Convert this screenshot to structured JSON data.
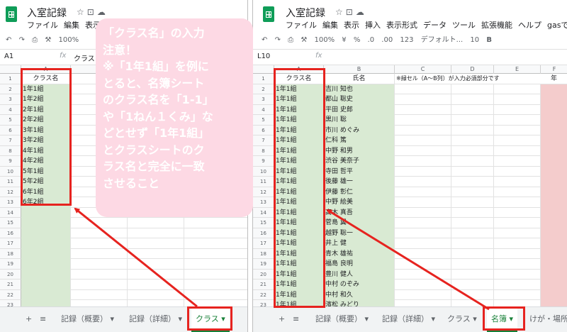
{
  "left": {
    "title": "入室記録",
    "menu": [
      "ファイル",
      "編集",
      "表示"
    ],
    "zoom": "100%",
    "cell_ref": "A1",
    "formula_value": "クラス",
    "col_header": "A",
    "header_cell": "クラス名",
    "classes": [
      "1年1組",
      "1年2組",
      "2年1組",
      "2年2組",
      "3年1組",
      "3年2組",
      "4年1組",
      "4年2組",
      "5年1組",
      "5年2組",
      "6年1組",
      "6年2組"
    ],
    "row_count": 23,
    "tabs": [
      "記録（概要）",
      "記録（詳細）",
      "クラス"
    ],
    "active_tab": "クラス"
  },
  "right": {
    "title": "入室記録",
    "menu": [
      "ファイル",
      "編集",
      "表示",
      "挿入",
      "表示形式",
      "データ",
      "ツール",
      "拡張機能",
      "ヘルプ",
      "gasで実行す"
    ],
    "toolbar": {
      "zoom": "100%",
      "currency": "¥",
      "percent": "%",
      "dec1": ".0",
      "dec2": ".00",
      "numfmt": "123",
      "font": "デフォルト...",
      "size": "10",
      "bold": "B"
    },
    "cell_ref": "L10",
    "col_headers": [
      "A",
      "B",
      "C",
      "D",
      "E",
      "F"
    ],
    "headers": {
      "class": "クラス名",
      "name": "氏名",
      "note": "※緑セル（A～B列）が入力必須部分です",
      "extra": "年"
    },
    "rows": [
      [
        "1年1組",
        "吉川 知也"
      ],
      [
        "1年1組",
        "都山 聡史"
      ],
      [
        "1年1組",
        "平田 史郎"
      ],
      [
        "1年1組",
        "黒川 聡"
      ],
      [
        "1年1組",
        "市川 めぐみ"
      ],
      [
        "1年1組",
        "仁科 篤"
      ],
      [
        "1年1組",
        "中野 和男"
      ],
      [
        "1年1組",
        "渋谷 美奈子"
      ],
      [
        "1年1組",
        "寺田 哲平"
      ],
      [
        "1年1組",
        "後藤 雄一"
      ],
      [
        "1年1組",
        "伊藤 彰仁"
      ],
      [
        "1年1組",
        "中野 絵美"
      ],
      [
        "1年1組",
        "高木 真吾"
      ],
      [
        "1年1組",
        "菅島 翼"
      ],
      [
        "1年1組",
        "越野 聡一"
      ],
      [
        "1年1組",
        "井上 健"
      ],
      [
        "1年1組",
        "青木 雄祐"
      ],
      [
        "1年1組",
        "福島 良明"
      ],
      [
        "1年1組",
        "豊川 健人"
      ],
      [
        "1年1組",
        "中村 のぞみ"
      ],
      [
        "1年1組",
        "中村 和久"
      ],
      [
        "1年1組",
        "濱松 みどり"
      ]
    ],
    "row_count": 23,
    "tabs": [
      "記録（概要）",
      "記録（詳細）",
      "クラス",
      "名簿",
      "けが・場所"
    ],
    "active_tab": "名簿"
  },
  "callout": {
    "lines": [
      "「クラス名」の入力",
      "注意！",
      "※「1年1組」を例に",
      "とると、名簿シート",
      "のクラス名を「1-1」",
      "や「1ねん１くみ」な",
      "どとせず「1年1組」",
      "とクラスシートのク",
      "ラス名と完全に一致",
      "させること"
    ]
  },
  "colors": {
    "green_cell": "#d9ead3",
    "pink_cell": "#f4cccc",
    "callout_bg": "#fdd9e4",
    "highlight_red": "#e6231f",
    "active_tab": "#188038"
  }
}
